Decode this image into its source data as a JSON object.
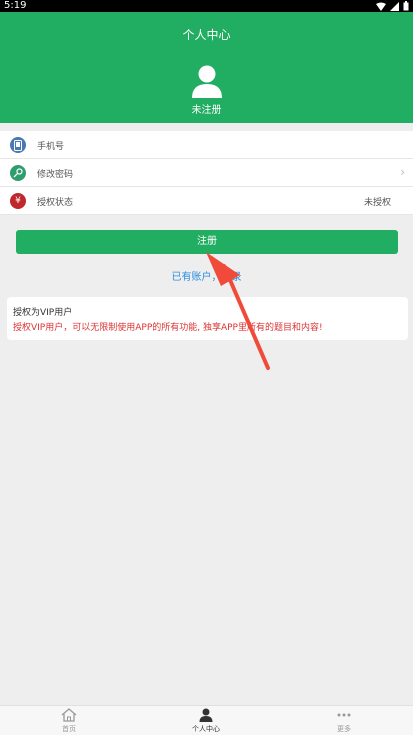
{
  "status_bar": {
    "time": "5:19"
  },
  "header": {
    "title": "个人中心",
    "user_status": "未注册"
  },
  "menu": [
    {
      "label": "手机号",
      "value": "",
      "icon": "phone-icon",
      "icon_color": "#4a78b4"
    },
    {
      "label": "修改密码",
      "value": "",
      "icon": "key-icon",
      "icon_color": "#2f9e6f"
    },
    {
      "label": "授权状态",
      "value": "未授权",
      "icon": "yen-icon",
      "icon_color": "#c0282c"
    }
  ],
  "register_button": "注册",
  "login_link": "已有账户，登录",
  "vip": {
    "title": "授权为VIP用户",
    "desc": "授权VIP用户，可以无限制使用APP的所有功能, 独享APP里所有的题目和内容!"
  },
  "tabs": [
    {
      "label": "首页",
      "icon": "home-icon"
    },
    {
      "label": "个人中心",
      "icon": "person-icon"
    },
    {
      "label": "更多",
      "icon": "more-icon"
    }
  ],
  "colors": {
    "accent": "#21ad62",
    "link": "#2a8ee0",
    "warning_text": "#dd3333"
  }
}
